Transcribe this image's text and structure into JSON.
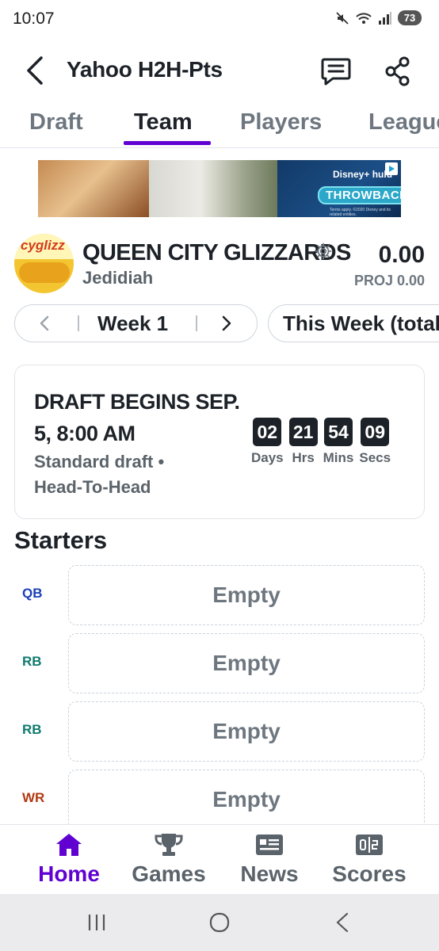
{
  "status_bar": {
    "time": "10:07",
    "battery": "73",
    "icons": [
      "mute-icon",
      "wifi-icon",
      "signal-icon",
      "battery-icon"
    ]
  },
  "header": {
    "title": "Yahoo H2H-Pts",
    "icons": [
      "back-arrow-icon",
      "chat-icon",
      "share-icon"
    ]
  },
  "tabs": [
    {
      "label": "Draft",
      "active": false
    },
    {
      "label": "Team",
      "active": true
    },
    {
      "label": "Players",
      "active": false
    },
    {
      "label": "League",
      "active": false
    }
  ],
  "ad": {
    "brand": "Disney+ hulu",
    "headline": "THROWBACKS",
    "fine_print": "Terms apply. ©2020 Disney and its related entities.",
    "icon": "ad-choices-icon"
  },
  "team": {
    "name": "QUEEN CITY GLIZZARDS",
    "manager": "Jedidiah",
    "score": "0.00",
    "projected": "PROJ 0.00",
    "avatar_text": "cyglizz"
  },
  "week_selector": {
    "label": "Week 1",
    "range_label": "This Week (total)"
  },
  "draft": {
    "title": "DRAFT BEGINS SEP. 5, 8:00 AM",
    "subtitle": "Standard draft • Head-To-Head",
    "countdown": [
      {
        "value": "02",
        "label": "Days"
      },
      {
        "value": "21",
        "label": "Hrs"
      },
      {
        "value": "54",
        "label": "Mins"
      },
      {
        "value": "09",
        "label": "Secs"
      }
    ]
  },
  "starters": {
    "title": "Starters",
    "slots": [
      {
        "position": "QB",
        "player": "Empty",
        "color": "#1a3fb8"
      },
      {
        "position": "RB",
        "player": "Empty",
        "color": "#0f7a6e"
      },
      {
        "position": "RB",
        "player": "Empty",
        "color": "#0f7a6e"
      },
      {
        "position": "WR",
        "player": "Empty",
        "color": "#b03a12"
      }
    ]
  },
  "bottom_nav": [
    {
      "label": "Home",
      "icon": "home-icon",
      "active": true
    },
    {
      "label": "Games",
      "icon": "trophy-icon",
      "active": false
    },
    {
      "label": "News",
      "icon": "news-icon",
      "active": false
    },
    {
      "label": "Scores",
      "icon": "scoreboard-icon",
      "active": false
    }
  ],
  "colors": {
    "accent": "#6001d2",
    "text": "#1d2228",
    "muted": "#6e7780"
  }
}
